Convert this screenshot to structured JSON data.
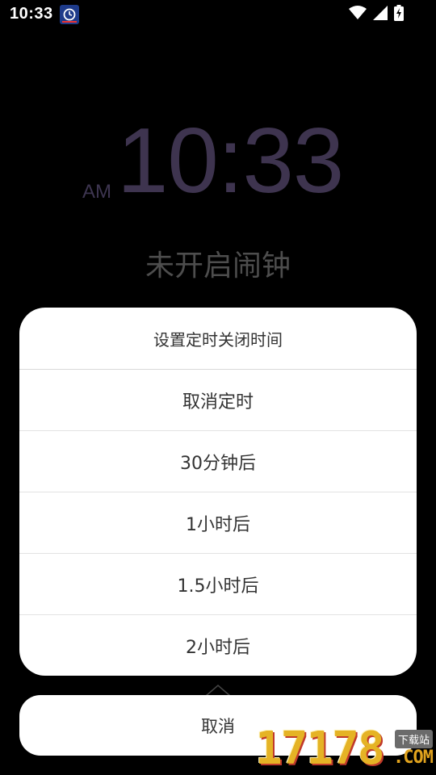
{
  "status_bar": {
    "time": "10:33",
    "app_icon": "alarm-clock-app-icon",
    "icons": [
      "wifi-icon",
      "cellular-signal-icon",
      "battery-charging-icon"
    ]
  },
  "clock": {
    "ampm": "AM",
    "time": "10:33",
    "alarm_status": "未开启闹钟",
    "color": "#3e344f"
  },
  "dialog": {
    "title": "设置定时关闭时间",
    "options": [
      {
        "label": "取消定时"
      },
      {
        "label": "30分钟后"
      },
      {
        "label": "1小时后"
      },
      {
        "label": "1.5小时后"
      },
      {
        "label": "2小时后"
      }
    ]
  },
  "cancel": {
    "label": "取消"
  },
  "watermark": {
    "digits": "17178",
    "tag": "下载站",
    "domain": ".COM"
  }
}
